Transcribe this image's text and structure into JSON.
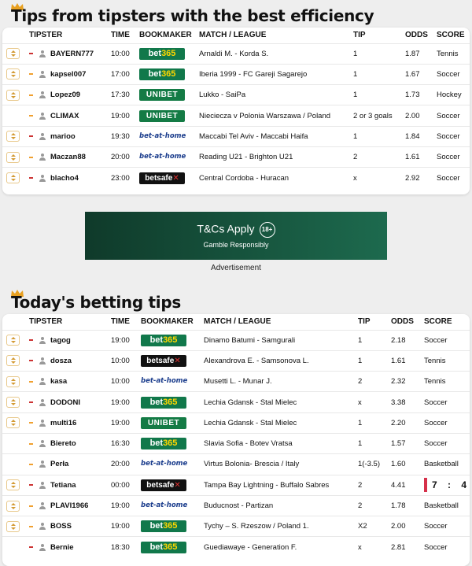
{
  "section1": {
    "title": "Tips from tipsters with the best efficiency",
    "columns": [
      "TIPSTER",
      "TIME",
      "BOOKMAKER",
      "MATCH / LEAGUE",
      "TIP",
      "ODDS",
      "SCORE"
    ],
    "rows": [
      {
        "tipster": "BAYERN777",
        "time": "10:00",
        "bookmaker": "bet365",
        "match": "Arnaldi M. - Korda S.",
        "tip": "1",
        "odds": "1.87",
        "score": "Tennis",
        "button": true,
        "dash": "red"
      },
      {
        "tipster": "kapsel007",
        "time": "17:00",
        "bookmaker": "bet365",
        "match": "Iberia 1999 - FC Gareji Sagarejo",
        "tip": "1",
        "odds": "1.67",
        "score": "Soccer",
        "button": true,
        "dash": "orange"
      },
      {
        "tipster": "Lopez09",
        "time": "17:30",
        "bookmaker": "UNIBET",
        "match": "Lukko - SaiPa",
        "tip": "1",
        "odds": "1.73",
        "score": "Hockey",
        "button": true,
        "dash": "orange"
      },
      {
        "tipster": "CLIMAX",
        "time": "19:00",
        "bookmaker": "UNIBET",
        "match": "Nieciecza v Polonia Warszawa / Poland",
        "tip": "2 or 3 goals",
        "odds": "2.00",
        "score": "Soccer",
        "button": false,
        "dash": "orange"
      },
      {
        "tipster": "marioo",
        "time": "19:30",
        "bookmaker": "bet-at-home",
        "match": "Maccabi Tel Aviv - Maccabi Haifa",
        "tip": "1",
        "odds": "1.84",
        "score": "Soccer",
        "button": true,
        "dash": "red"
      },
      {
        "tipster": "Maczan88",
        "time": "20:00",
        "bookmaker": "bet-at-home",
        "match": "Reading U21 - Brighton U21",
        "tip": "2",
        "odds": "1.61",
        "score": "Soccer",
        "button": true,
        "dash": "orange"
      },
      {
        "tipster": "blacho4",
        "time": "23:00",
        "bookmaker": "betsafe",
        "match": "Central Cordoba - Huracan",
        "tip": "x",
        "odds": "2.92",
        "score": "Soccer",
        "button": true,
        "dash": "red"
      }
    ]
  },
  "ad": {
    "main": "T&Cs Apply",
    "age": "18+",
    "sub": "Gamble Responsibly",
    "label": "Advertisement"
  },
  "section2": {
    "title": "Today's betting tips",
    "columns": [
      "TIPSTER",
      "TIME",
      "BOOKMAKER",
      "MATCH / LEAGUE",
      "TIP",
      "ODDS",
      "SCORE"
    ],
    "rows": [
      {
        "tipster": "tagog",
        "time": "19:00",
        "bookmaker": "bet365",
        "match": "Dinamo Batumi - Samgurali",
        "tip": "1",
        "odds": "2.18",
        "score": "Soccer",
        "button": true,
        "dash": "red"
      },
      {
        "tipster": "dosza",
        "time": "10:00",
        "bookmaker": "betsafe",
        "match": "Alexandrova E. - Samsonova L.",
        "tip": "1",
        "odds": "1.61",
        "score": "Tennis",
        "button": true,
        "dash": "red"
      },
      {
        "tipster": "kasa",
        "time": "10:00",
        "bookmaker": "bet-at-home",
        "match": "Musetti L. - Munar J.",
        "tip": "2",
        "odds": "2.32",
        "score": "Tennis",
        "button": true,
        "dash": "orange"
      },
      {
        "tipster": "DODONI",
        "time": "19:00",
        "bookmaker": "bet365",
        "match": "Lechia Gdansk - Stal Mielec",
        "tip": "x",
        "odds": "3.38",
        "score": "Soccer",
        "button": true,
        "dash": "red"
      },
      {
        "tipster": "multi16",
        "time": "19:00",
        "bookmaker": "UNIBET",
        "match": "Lechia Gdansk - Stal Mielec",
        "tip": "1",
        "odds": "2.20",
        "score": "Soccer",
        "button": true,
        "dash": "orange"
      },
      {
        "tipster": "Biereto",
        "time": "16:30",
        "bookmaker": "bet365",
        "match": "Slavia Sofia - Botev Vratsa",
        "tip": "1",
        "odds": "1.57",
        "score": "Soccer",
        "button": false,
        "dash": "orange"
      },
      {
        "tipster": "Perła",
        "time": "20:00",
        "bookmaker": "bet-at-home",
        "match": "Virtus Bolonia- Brescia / Italy",
        "tip": "1(-3.5)",
        "odds": "1.60",
        "score": "Basketball",
        "button": false,
        "dash": "orange"
      },
      {
        "tipster": "Tetiana",
        "time": "00:00",
        "bookmaker": "betsafe",
        "match": "Tampa Bay Lightning - Buffalo Sabres",
        "tip": "2",
        "odds": "4.41",
        "score": "7 : 4",
        "button": true,
        "dash": "red",
        "live_score": true
      },
      {
        "tipster": "PLAVI1966",
        "time": "19:00",
        "bookmaker": "bet-at-home",
        "match": "Buducnost - Partizan",
        "tip": "2",
        "odds": "1.78",
        "score": "Basketball",
        "button": true,
        "dash": "orange"
      },
      {
        "tipster": "BOSS",
        "time": "19:00",
        "bookmaker": "bet365",
        "match": "Tychy – S. Rzeszow / Poland 1.",
        "tip": "X2",
        "odds": "2.00",
        "score": "Soccer",
        "button": true,
        "dash": "orange"
      },
      {
        "tipster": "Bernie",
        "time": "18:30",
        "bookmaker": "bet365",
        "match": "Guediawaye - Generation F.",
        "tip": "x",
        "odds": "2.81",
        "score": "Soccer",
        "button": false,
        "dash": "red"
      }
    ]
  },
  "colors": {
    "bet365": "#11784b",
    "unibet": "#147b45",
    "betathome": "#1a3c8c",
    "betsafe": "#111111",
    "accent_gold": "#d39a33",
    "live_bar": "#d6304a"
  }
}
